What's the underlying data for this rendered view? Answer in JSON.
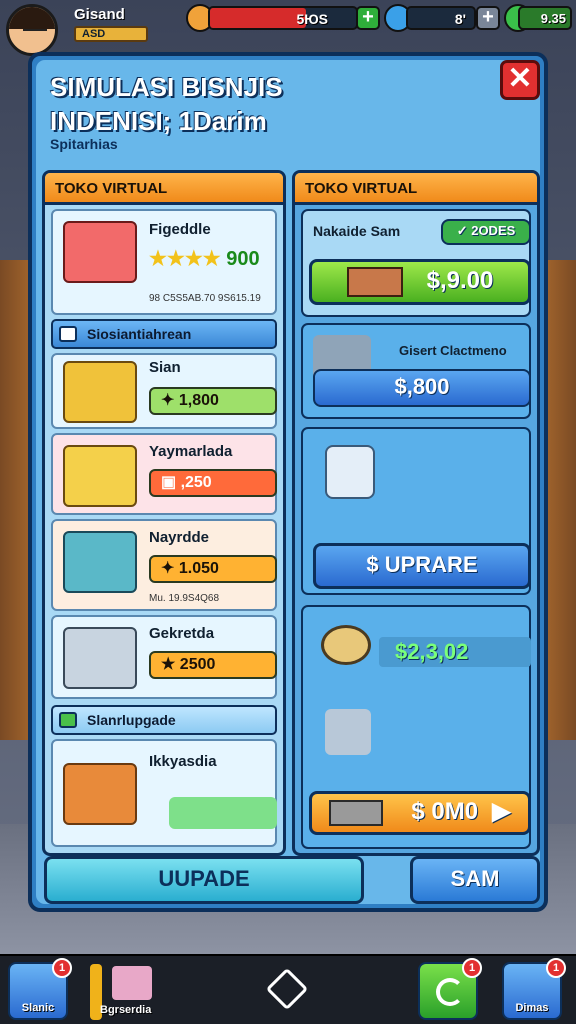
{
  "hud": {
    "player_name": "Gisand",
    "player_level": "ASD",
    "health_value": "5ЮS",
    "health_fraction": 0.66,
    "gems_value": "8'",
    "cash_value": "9.35"
  },
  "panel": {
    "title_line1": "SIMULASI BISNJIS",
    "title_line2": "INDENISI; 1Darim",
    "subtitle": "Spitarhias",
    "close_glyph": "✕"
  },
  "left": {
    "header": "TOKO VIRTUAL",
    "items": [
      {
        "title": "Figeddle",
        "value": "900",
        "sub": "98 C5S5AB.70 9S615.19"
      },
      {
        "section": "Siosiantiahrean"
      },
      {
        "title": "Sian",
        "value": "1,800"
      },
      {
        "title": "Yaymarlada",
        "value": ",250"
      },
      {
        "title": "Nayrdde",
        "value": "1.050",
        "sub": "Mu. 19.9S4Q68"
      },
      {
        "title": "Gekretda",
        "value": "2500"
      },
      {
        "section": "Slanrlupgade"
      },
      {
        "title": "Ikkyasdia",
        "value": ""
      }
    ]
  },
  "right": {
    "header": "TOKO VIRTUAL",
    "card1": {
      "label": "Nakaide Sam",
      "badge": "2ODES",
      "price": "$,9.00"
    },
    "card2": {
      "label": "Gisert Clactmeno",
      "price": "$,800"
    },
    "card3": {
      "button": "$  UPRARE"
    },
    "card4": {
      "price": "$2,3,02",
      "button": "$ 0M0"
    }
  },
  "buttons": {
    "upgrade": "UUPADE",
    "sam": "SAM"
  },
  "nav": {
    "items": [
      {
        "label": "Slanic",
        "badge": "1"
      },
      {
        "label": "Bgrserdia",
        "badge": ""
      },
      {
        "label": "",
        "badge": ""
      },
      {
        "label": "",
        "badge": "1"
      },
      {
        "label": "Dimas",
        "badge": "1"
      }
    ]
  }
}
